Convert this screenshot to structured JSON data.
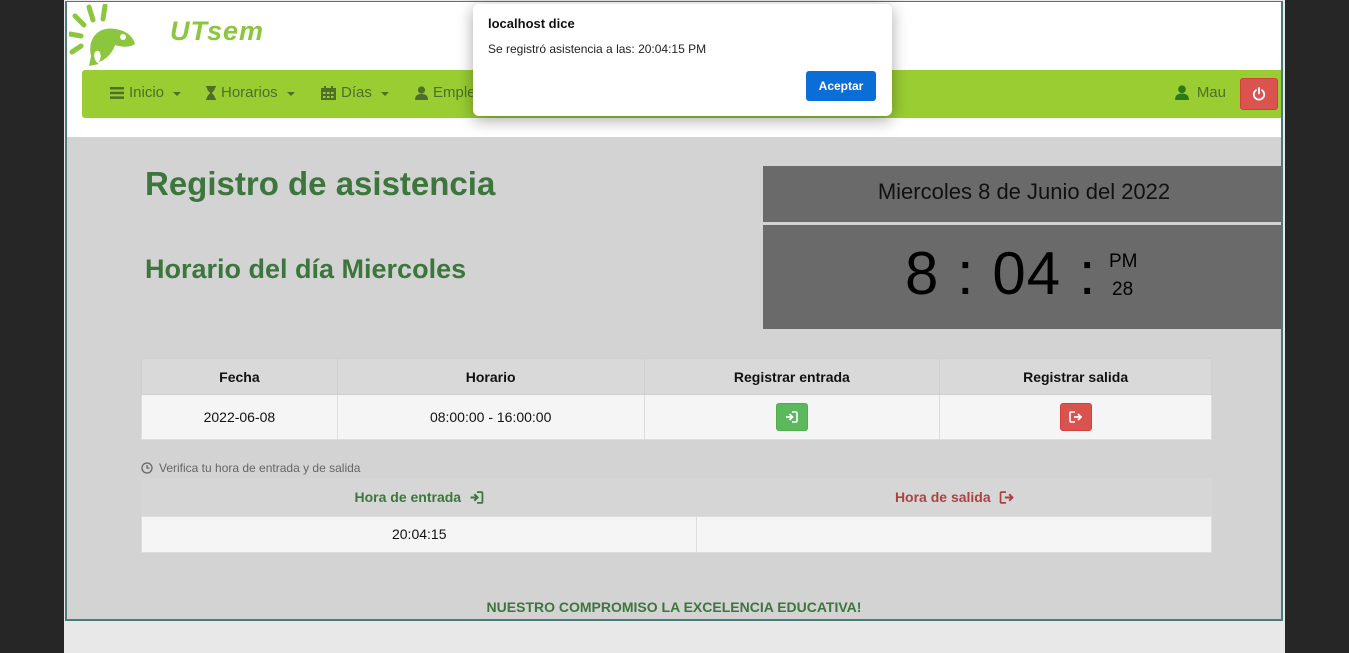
{
  "brand": {
    "name": "UTsem",
    "color": "#8cc63f"
  },
  "nav": {
    "items": [
      {
        "label": "Inicio",
        "icon": "menu-icon"
      },
      {
        "label": "Horarios",
        "icon": "hourglass-icon"
      },
      {
        "label": "Días",
        "icon": "calendar-icon"
      },
      {
        "label": "Emple",
        "icon": "user-icon"
      }
    ],
    "user": "Mau",
    "bg_color": "#9acd32"
  },
  "main": {
    "title": "Registro de asistencia",
    "subtitle": "Horario del día Miercoles",
    "date": "Miercoles 8 de Junio del 2022",
    "clock": {
      "hour": "8",
      "minutes": "04",
      "separator": ":",
      "ampm": "PM",
      "seconds": "28"
    }
  },
  "schedule": {
    "headers": [
      "Fecha",
      "Horario",
      "Registrar entrada",
      "Registrar salida"
    ],
    "row": {
      "fecha": "2022-06-08",
      "horario": "08:00:00 - 16:00:00"
    }
  },
  "verify_note": "Verifica tu hora de entrada y de salida",
  "hours": {
    "entry_header": "Hora de entrada",
    "exit_header": "Hora de salida",
    "entry_value": "20:04:15",
    "exit_value": ""
  },
  "footer": "NUESTRO COMPROMISO LA EXCELENCIA EDUCATIVA!",
  "dialog": {
    "title": "localhost dice",
    "message": "Se registró asistencia a las: 20:04:15 PM",
    "ok_label": "Aceptar"
  }
}
